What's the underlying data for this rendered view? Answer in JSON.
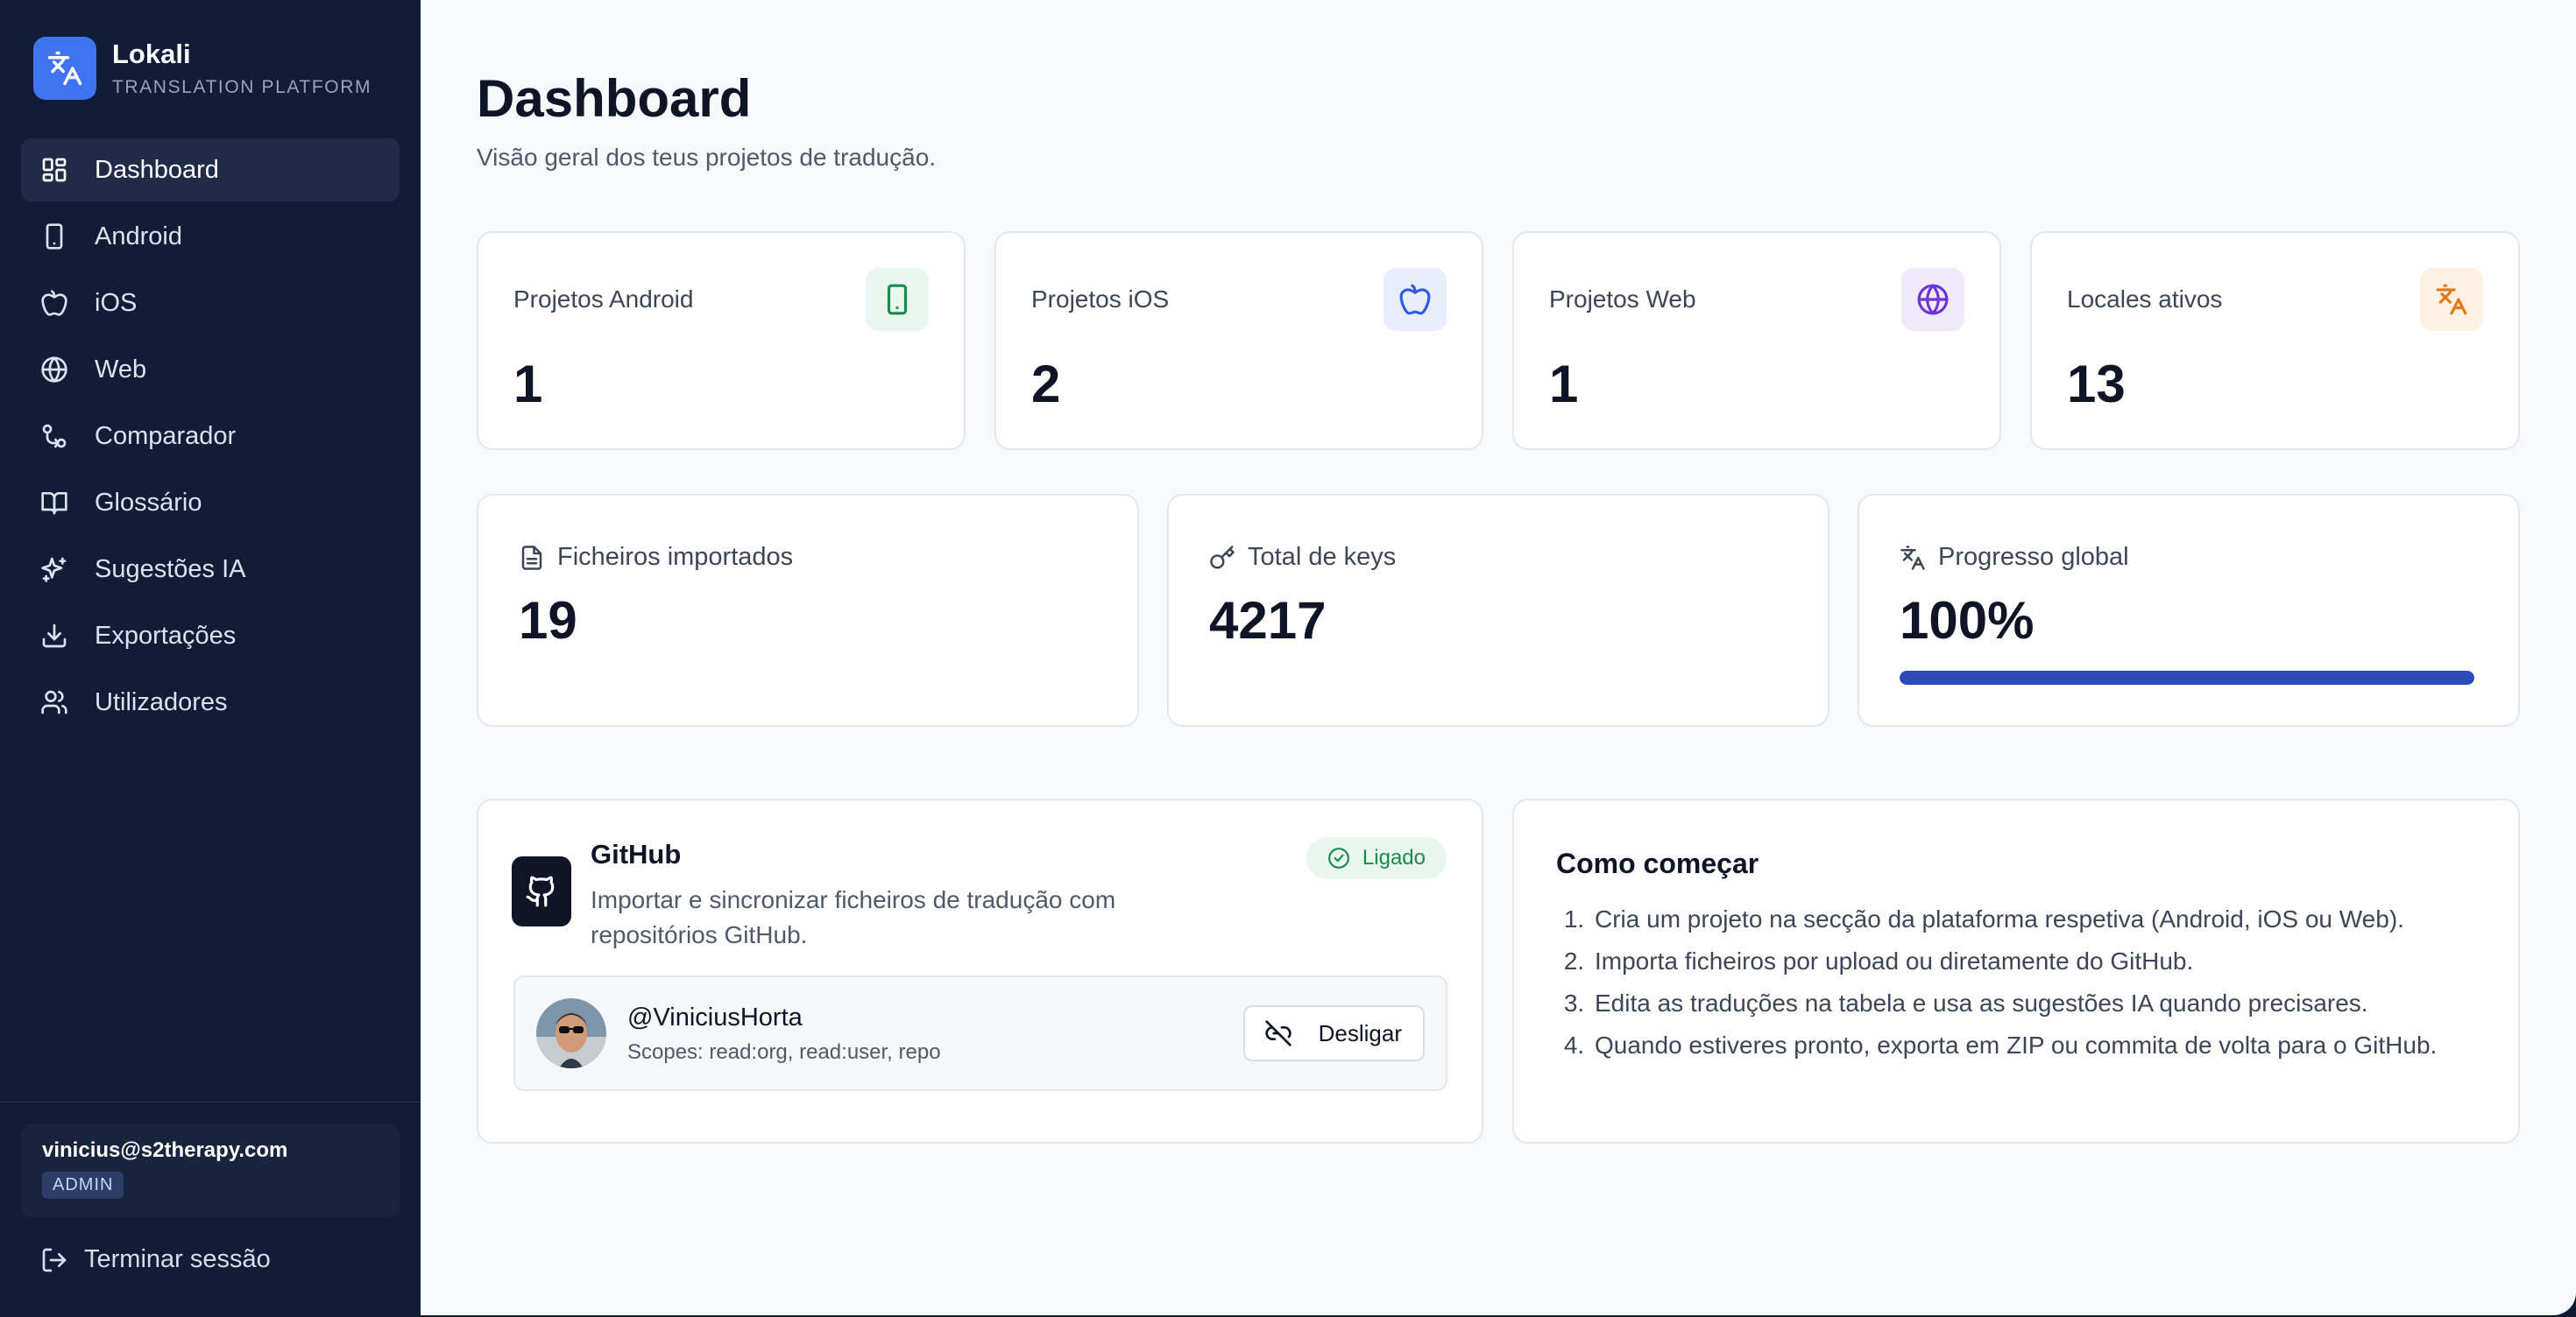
{
  "brand": {
    "name": "Lokali",
    "tagline": "TRANSLATION PLATFORM"
  },
  "sidebar": {
    "items": [
      {
        "label": "Dashboard",
        "icon": "dashboard-icon",
        "active": true
      },
      {
        "label": "Android",
        "icon": "smartphone-icon"
      },
      {
        "label": "iOS",
        "icon": "apple-icon"
      },
      {
        "label": "Web",
        "icon": "globe-icon"
      },
      {
        "label": "Comparador",
        "icon": "compare-icon"
      },
      {
        "label": "Glossário",
        "icon": "book-icon"
      },
      {
        "label": "Sugestões IA",
        "icon": "sparkles-icon"
      },
      {
        "label": "Exportações",
        "icon": "download-icon"
      },
      {
        "label": "Utilizadores",
        "icon": "users-icon"
      }
    ],
    "user": {
      "email": "vinicius@s2therapy.com",
      "role": "ADMIN"
    },
    "logout_label": "Terminar sessão"
  },
  "header": {
    "title": "Dashboard",
    "subtitle": "Visão geral dos teus projetos de tradução."
  },
  "stats": [
    {
      "label": "Projetos Android",
      "value": "1",
      "icon": "smartphone-icon",
      "color": "#1a8a4a",
      "bg": "#e9f6ef"
    },
    {
      "label": "Projetos iOS",
      "value": "2",
      "icon": "apple-icon",
      "color": "#2d5be3",
      "bg": "#e8eefb"
    },
    {
      "label": "Projetos Web",
      "value": "1",
      "icon": "globe-icon",
      "color": "#6a35d9",
      "bg": "#f1eafb"
    },
    {
      "label": "Locales ativos",
      "value": "13",
      "icon": "translate-icon",
      "color": "#e07a1a",
      "bg": "#fdf1e4"
    }
  ],
  "stats2": [
    {
      "label": "Ficheiros importados",
      "value": "19",
      "icon": "file-icon"
    },
    {
      "label": "Total de keys",
      "value": "4217",
      "icon": "key-icon"
    },
    {
      "label": "Progresso global",
      "value": "100%",
      "icon": "translate-icon",
      "progress": 1.0
    }
  ],
  "github": {
    "title": "GitHub",
    "description": "Importar e sincronizar ficheiros de tradução com repositórios GitHub.",
    "status": "Ligado",
    "account": {
      "username": "@ViniciusHorta",
      "scopes": "Scopes: read:org, read:user, repo"
    },
    "disconnect_label": "Desligar"
  },
  "howto": {
    "title": "Como começar",
    "steps": [
      "Cria um projeto na secção da plataforma respetiva (Android, iOS ou Web).",
      "Importa ficheiros por upload ou diretamente do GitHub.",
      "Edita as traduções na tabela e usa as sugestões IA quando precisares.",
      "Quando estiveres pronto, exporta em ZIP ou commita de volta para o GitHub."
    ]
  },
  "colors": {
    "sidebar_bg": "#111c37",
    "accent": "#3f74f0",
    "progress": "#2a4bb8",
    "success": "#1a8a4a"
  }
}
